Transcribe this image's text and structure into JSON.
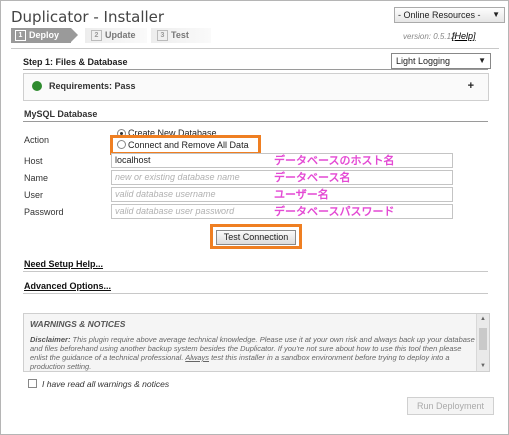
{
  "header": {
    "title": "Duplicator - Installer",
    "resources_label": "- Online Resources -",
    "version": "version: 0.5.12",
    "help_label": "[Help]"
  },
  "steps": [
    {
      "num": "1",
      "label": "Deploy"
    },
    {
      "num": "2",
      "label": "Update"
    },
    {
      "num": "3",
      "label": "Test"
    }
  ],
  "step1": {
    "title": "Step 1: Files & Database",
    "logging_value": "Light Logging"
  },
  "requirements": {
    "label": "Requirements: Pass",
    "expand": "+",
    "status_color": "#2e8b2e"
  },
  "mysql": {
    "title": "MySQL Database",
    "action_label": "Action",
    "actions": [
      {
        "label": "Create New Database",
        "checked": true
      },
      {
        "label": "Connect and Remove All Data",
        "checked": false
      }
    ],
    "host": {
      "label": "Host",
      "value": "localhost",
      "annotation": "データベースのホスト名"
    },
    "name": {
      "label": "Name",
      "placeholder": "new or existing database name",
      "annotation": "データベース名"
    },
    "user": {
      "label": "User",
      "placeholder": "valid database username",
      "annotation": "ユーザー名"
    },
    "password": {
      "label": "Password",
      "placeholder": "valid database user password",
      "annotation": "データベースパスワード"
    },
    "test_button": "Test Connection"
  },
  "links": {
    "setup_help": "Need Setup Help...",
    "advanced": "Advanced Options..."
  },
  "notices": {
    "title": "WARNINGS & NOTICES",
    "disclaimer_label": "Disclaimer:",
    "body_1": " This plugin require above average technical knowledge. Please use it at your own risk and always back up your database and files beforehand using another backup system besides the Duplicator. If you're not sure about how to use this tool then please enlist the guidance of a technical professional. ",
    "always": "Always",
    "body_2": " test this installer in a sandbox environment before trying to deploy into a production setting."
  },
  "confirm_label": "I have read all warnings & notices",
  "run_button": "Run Deployment",
  "colors": {
    "annotation": "#e44ad4",
    "highlight": "#ef7f22",
    "status_pass": "#2e8b2e"
  }
}
